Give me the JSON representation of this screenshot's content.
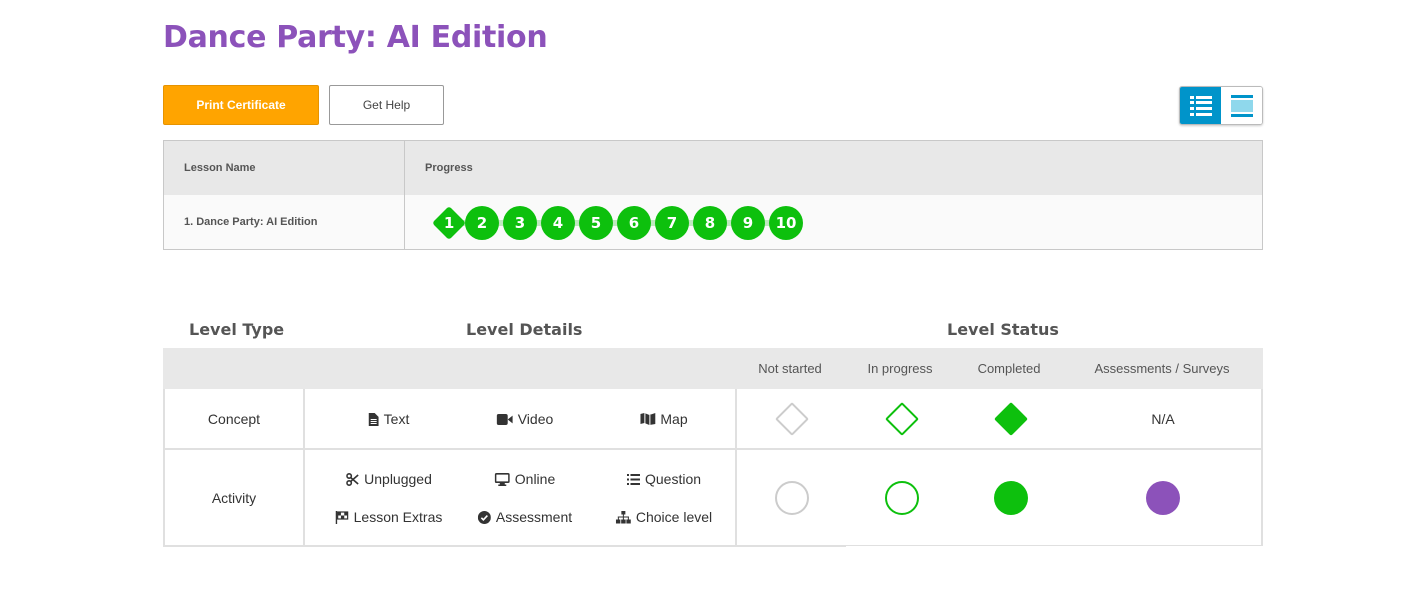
{
  "page": {
    "title": "Dance Party: AI Edition"
  },
  "actions": {
    "print_label": "Print Certificate",
    "help_label": "Get Help"
  },
  "view_toggle": {
    "detail_icon": "list-detail-icon",
    "summary_icon": "list-summary-icon",
    "selected": "detail"
  },
  "progress_table": {
    "col_lesson": "Lesson Name",
    "col_progress": "Progress",
    "lesson": "1. Dance Party: AI Edition",
    "levels": [
      "1",
      "2",
      "3",
      "4",
      "5",
      "6",
      "7",
      "8",
      "9",
      "10"
    ],
    "level_status": "completed"
  },
  "key": {
    "heading_type": "Level Type",
    "heading_details": "Level Details",
    "heading_status": "Level Status",
    "statuses": [
      "Not started",
      "In progress",
      "Completed",
      "Assessments / Surveys"
    ],
    "concept": {
      "label": "Concept",
      "details": [
        "Text",
        "Video",
        "Map"
      ],
      "assessment": "N/A"
    },
    "activity": {
      "label": "Activity",
      "details": [
        "Unplugged",
        "Online",
        "Question",
        "Lesson Extras",
        "Assessment",
        "Choice level"
      ]
    }
  },
  "colors": {
    "green": "#0dc00d",
    "purple": "#8c52ba",
    "orange": "#ffa400",
    "blue": "#0094ca"
  }
}
